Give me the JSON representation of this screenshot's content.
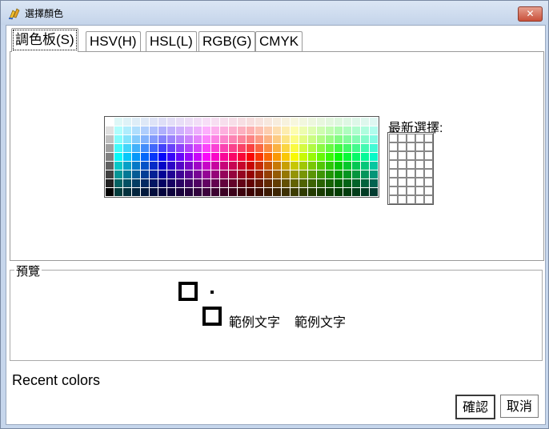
{
  "window": {
    "title": "選擇顏色",
    "close_glyph": "✕"
  },
  "tabs": [
    {
      "label": "調色板(S)",
      "active": true
    },
    {
      "label": "HSV(H)",
      "active": false
    },
    {
      "label": "HSL(L)",
      "active": false
    },
    {
      "label": "RGB(G)",
      "active": false
    },
    {
      "label": "CMYK",
      "active": false
    }
  ],
  "palette": {
    "recent_label": "最新選擇:"
  },
  "preview": {
    "legend": "預覽",
    "sample_text_1": "範例文字",
    "sample_text_2": "範例文字"
  },
  "footer": {
    "recent_colors": "Recent colors",
    "ok_label": "確認",
    "cancel_label": "取消"
  },
  "icons": {
    "title_icon": "palette-icon",
    "close_icon": "close-icon"
  }
}
